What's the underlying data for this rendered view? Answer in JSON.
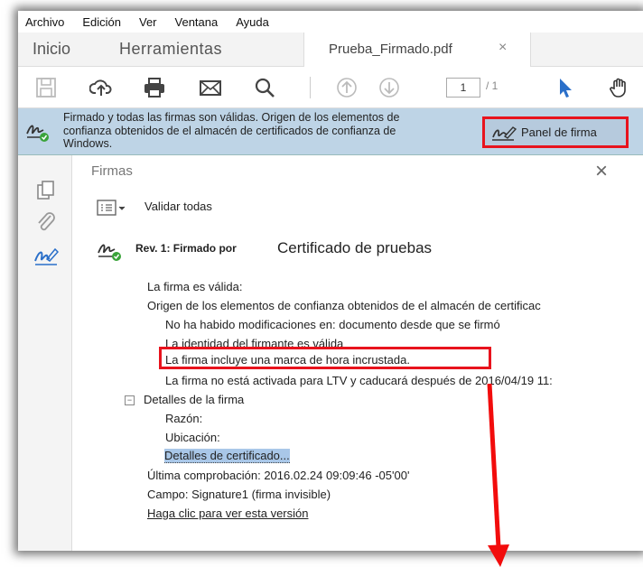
{
  "menu": [
    "Archivo",
    "Edición",
    "Ver",
    "Ventana",
    "Ayuda"
  ],
  "tabs": {
    "home": "Inicio",
    "tools": "Herramientas",
    "document": "Prueba_Firmado.pdf",
    "close": "×"
  },
  "toolbar": {
    "page_current": "1",
    "page_total": "/ 1"
  },
  "banner": {
    "message": "Firmado y todas las firmas son válidas. Origen de los elementos de confianza obtenidos de el almacén de certificados de confianza de Windows.",
    "panel_button": "Panel de firma",
    "bg_color": "#bed4e6",
    "highlight_color": "#e8131d"
  },
  "panel": {
    "title": "Firmas",
    "close": "×",
    "validate_all": "Validar todas",
    "revision": "Rev. 1: Firmado por",
    "signer": "Certificado de pruebas",
    "lines": {
      "valid": "La firma es válida:",
      "trust_origin": "Origen de los elementos de confianza obtenidos de el almacén de certificac",
      "no_changes": "No ha habido modificaciones en: documento desde que se firmó",
      "identity": "La identidad del firmante es válida",
      "timestamp": "La firma incluye una marca de hora incrustada.",
      "ltv": "La firma no está activada para LTV y caducará después de 2016/04/19 11:",
      "details": "Detalles de la firma",
      "reason": "Razón:",
      "location": "Ubicación:",
      "cert_details": "Detalles de certificado...",
      "last_check": "Última comprobación: 2016.02.24 09:09:46 -05'00'",
      "field": "Campo: Signature1 (firma invisible)",
      "view_version": "Haga clic para ver esta versión"
    }
  }
}
